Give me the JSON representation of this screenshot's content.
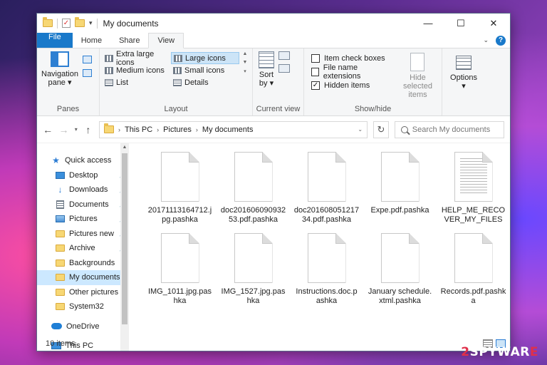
{
  "window": {
    "title": "My documents",
    "caption": {
      "minimize": "—",
      "maximize": "☐",
      "close": "✕"
    }
  },
  "tabs": [
    {
      "label": "File"
    },
    {
      "label": "Home"
    },
    {
      "label": "Share"
    },
    {
      "label": "View"
    }
  ],
  "ribbon": {
    "panes": {
      "label": "Panes",
      "navigation_pane": [
        "Navigation",
        "pane ▾"
      ]
    },
    "layout": {
      "label": "Layout",
      "items": [
        "Extra large icons",
        "Large icons",
        "Medium icons",
        "Small icons",
        "List",
        "Details"
      ],
      "selected": "Large icons"
    },
    "current_view": {
      "label": "Current view",
      "sort_by": [
        "Sort",
        "by ▾"
      ]
    },
    "show_hide": {
      "label": "Show/hide",
      "item_check_boxes": "Item check boxes",
      "file_name_extensions": "File name extensions",
      "hidden_items": "Hidden items",
      "hide_selected": [
        "Hide selected",
        "items"
      ]
    },
    "options": {
      "label": "Options",
      "caret": "▾"
    }
  },
  "address": {
    "crumbs": [
      "This PC",
      "Pictures",
      "My documents"
    ],
    "search_placeholder": "Search My documents"
  },
  "nav": {
    "quick_access": "Quick access",
    "items": [
      {
        "label": "Desktop",
        "pinned": true
      },
      {
        "label": "Downloads",
        "pinned": true
      },
      {
        "label": "Documents",
        "pinned": true
      },
      {
        "label": "Pictures",
        "pinned": true
      },
      {
        "label": "Pictures new",
        "pinned": true
      },
      {
        "label": "Archive",
        "pinned": true
      },
      {
        "label": "Backgrounds",
        "pinned": false
      },
      {
        "label": "My documents",
        "pinned": false
      },
      {
        "label": "Other pictures",
        "pinned": false
      },
      {
        "label": "System32",
        "pinned": false
      }
    ],
    "onedrive": "OneDrive",
    "this_pc": "This PC"
  },
  "files": [
    {
      "name": "20171113164712.jpg.pashka"
    },
    {
      "name": "doc20160609093253.pdf.pashka"
    },
    {
      "name": "doc20160805121734.pdf.pashka"
    },
    {
      "name": "Expe.pdf.pashka"
    },
    {
      "name": "HELP_ME_RECOVER_MY_FILES"
    },
    {
      "name": "IMG_1011.jpg.pashka"
    },
    {
      "name": "IMG_1527.jpg.pashka"
    },
    {
      "name": "Instructions.doc.pashka"
    },
    {
      "name": "January schedule.xtml.pashka"
    },
    {
      "name": "Records.pdf.pashka"
    }
  ],
  "status": {
    "count": "10 items"
  },
  "watermark": {
    "prefix": "2",
    "brand": "SPYWAR",
    "suffix": "E"
  }
}
